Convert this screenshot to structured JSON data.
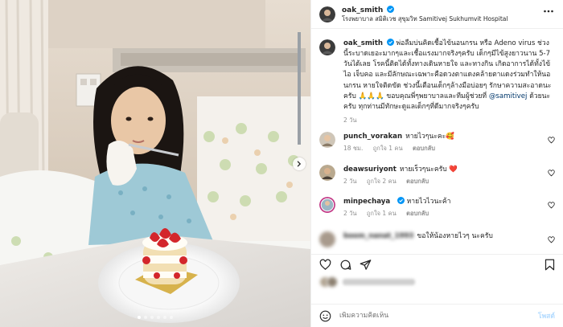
{
  "post": {
    "author": "oak_smith",
    "location": "โรงพยาบาล สมิติเวช สุขุมวิท Samitivej Sukhumvit Hospital",
    "caption_user": "oak_smith",
    "caption_part1": "พ่อลืมบ่นคิดเชื้อไข้นอนกรน หรือ Adeno virus ช่วงนี้ระบาดเยอะมากๆและเชื้อแรงมากจริงๆครับ เด็กๆมีไข้สูงยาวนาน 5-7 วันได้เลย โรคนี้ติดได้ทั้งทางเดินหายใจ และทางกิน เกิดอาการได้ทั้งไข้ ไอ เจ็บคอ และมีลักษณะเฉพาะคือดวงตาแดงคล้ายตาแดงร่วมทำให้นอนกรน หายใจติดขัด ช่วงนี้เตือนเด็กๆล้างมือบ่อยๆ รักษาความสะอาดนะครับ 🙏🙏🙏 ขอบคุณพี่ๆพยาบาลและทีมผู้ช่วยที่",
    "caption_mention": "@samitivej",
    "caption_part2": "ด้วยนะครับ ทุกท่านมีทักษะดูแลเด็กๆที่ดีมากจริงๆครับ",
    "time_ago": "2 วัน"
  },
  "comments": [
    {
      "user": "punch_vorakan",
      "text": "หายไวๆนะคะ🥰",
      "time": "18 ชม.",
      "likes": "ถูกใจ 1 คน",
      "reply": "ตอบกลับ",
      "verified": false,
      "blur": false
    },
    {
      "user": "deawsuriyont",
      "text": "หายเร็วๆนะครับ ❤️",
      "time": "2 วัน",
      "likes": "ถูกใจ 2 คน",
      "reply": "ตอบกลับ",
      "verified": false,
      "blur": false
    },
    {
      "user": "minpechaya",
      "text": "หายไวไวนะค้า",
      "time": "2 วัน",
      "likes": "ถูกใจ 1 คน",
      "reply": "ตอบกลับ",
      "verified": true,
      "blur": false
    },
    {
      "user": "boom_nanat_1993",
      "text": "ขอให้น้องหายไวๆ นะครับ",
      "time": "",
      "likes": "",
      "reply": "",
      "verified": false,
      "blur": true
    }
  ],
  "actions": {
    "like": "heart-icon",
    "comment": "comment-icon",
    "share": "paper-plane-icon",
    "save": "bookmark-icon"
  },
  "add_comment": {
    "placeholder": "เพิ่มความคิดเห็น",
    "post_label": "โพสต์"
  },
  "carousel": {
    "total": 6,
    "active_index": 0
  },
  "colors": {
    "verified": "#0095f6",
    "heart_red": "#ed4956",
    "link": "#00376b",
    "post_disabled": "#b3dbff"
  }
}
